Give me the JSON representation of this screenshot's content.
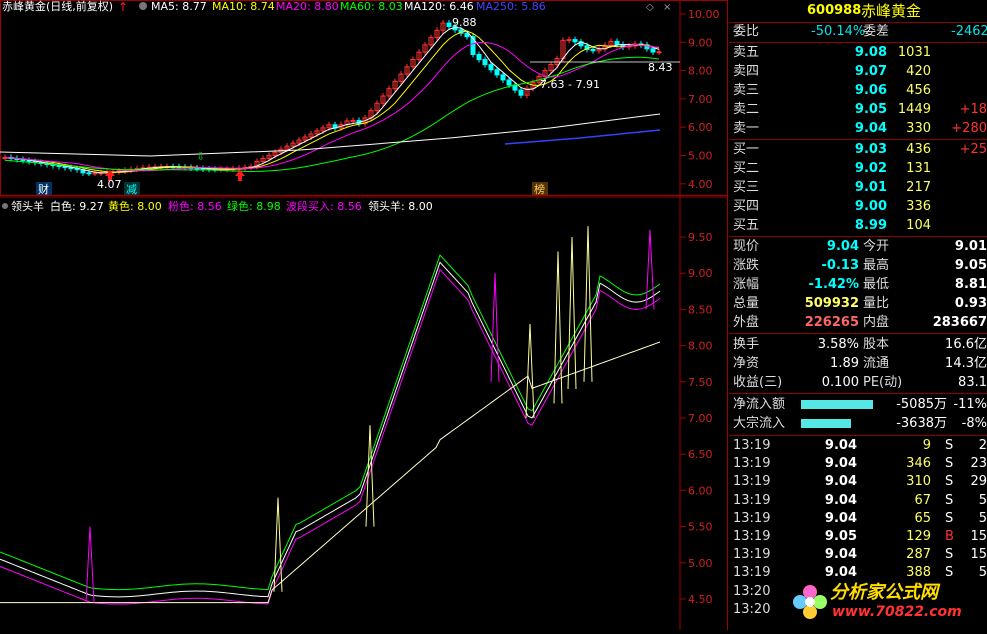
{
  "header": {
    "title": "赤峰黄金(日线,前复权)",
    "ma": [
      {
        "label": "MA5: 8.77",
        "color": "#ffffff"
      },
      {
        "label": "MA10: 8.74",
        "color": "#ffff00"
      },
      {
        "label": "MA20: 8.80",
        "color": "#ff00ff"
      },
      {
        "label": "MA60: 8.03",
        "color": "#00ff00"
      },
      {
        "label": "MA120: 6.46",
        "color": "#ffffff"
      },
      {
        "label": "MA250: 5.86",
        "color": "#4444ff"
      }
    ]
  },
  "upper_axis": [
    "10.00",
    "9.00",
    "8.00",
    "7.00",
    "6.00",
    "5.00",
    "4.00"
  ],
  "upper_annotations": {
    "high": "9.88",
    "low": "4.07",
    "range": "7.63 - 7.91",
    "right": "8.43",
    "marker_cai": "财",
    "marker_jian": "减",
    "marker_bang": "榜"
  },
  "indicator_header": {
    "name": "领头羊",
    "items": [
      {
        "label": "白色: 9.27",
        "color": "#ffffff"
      },
      {
        "label": "黄色: 8.00",
        "color": "#ffff00"
      },
      {
        "label": "粉色: 8.56",
        "color": "#ff00ff"
      },
      {
        "label": "绿色: 8.98",
        "color": "#00ff00"
      },
      {
        "label": "波段买入: 8.56",
        "color": "#ff00ff"
      },
      {
        "label": "领头羊: 8.00",
        "color": "#ffffff"
      }
    ]
  },
  "lower_axis": [
    "9.50",
    "9.00",
    "8.50",
    "8.00",
    "7.50",
    "7.00",
    "6.50",
    "6.00",
    "5.50",
    "5.00",
    "4.50"
  ],
  "quote": {
    "code": "600988",
    "name": "赤峰黄金",
    "weibi_label": "委比",
    "weibi": "-50.14%",
    "weicha_label": "委差",
    "weicha": "-2462",
    "sell": [
      {
        "label": "卖五",
        "price": "9.08",
        "vol": "1031",
        "chg": ""
      },
      {
        "label": "卖四",
        "price": "9.07",
        "vol": "420",
        "chg": ""
      },
      {
        "label": "卖三",
        "price": "9.06",
        "vol": "456",
        "chg": ""
      },
      {
        "label": "卖二",
        "price": "9.05",
        "vol": "1449",
        "chg": "+18"
      },
      {
        "label": "卖一",
        "price": "9.04",
        "vol": "330",
        "chg": "+280"
      }
    ],
    "buy": [
      {
        "label": "买一",
        "price": "9.03",
        "vol": "436",
        "chg": "+25"
      },
      {
        "label": "买二",
        "price": "9.02",
        "vol": "131",
        "chg": ""
      },
      {
        "label": "买三",
        "price": "9.01",
        "vol": "217",
        "chg": ""
      },
      {
        "label": "买四",
        "price": "9.00",
        "vol": "336",
        "chg": ""
      },
      {
        "label": "买五",
        "price": "8.99",
        "vol": "104",
        "chg": ""
      }
    ],
    "stats": [
      {
        "l1": "现价",
        "v1": "9.04",
        "l2": "今开",
        "v2": "9.01"
      },
      {
        "l1": "涨跌",
        "v1": "-0.13",
        "l2": "最高",
        "v2": "9.05"
      },
      {
        "l1": "涨幅",
        "v1": "-1.42%",
        "l2": "最低",
        "v2": "8.81"
      },
      {
        "l1": "总量",
        "v1": "509932",
        "l2": "量比",
        "v2": "0.93"
      },
      {
        "l1": "外盘",
        "v1": "226265",
        "l2": "内盘",
        "v2": "283667"
      }
    ],
    "finance": [
      {
        "l1": "换手",
        "v1": "3.58%",
        "l2": "股本",
        "v2": "16.6亿"
      },
      {
        "l1": "净资",
        "v1": "1.89",
        "l2": "流通",
        "v2": "14.3亿"
      },
      {
        "l1": "收益(三)",
        "v1": "0.100",
        "l2": "PE(动)",
        "v2": "83.1"
      }
    ],
    "flow": [
      {
        "label": "净流入额",
        "value": "-5085万",
        "pct": "-11%"
      },
      {
        "label": "大宗流入",
        "value": "-3638万",
        "pct": "-8%"
      }
    ]
  },
  "ticks": [
    {
      "time": "13:19",
      "price": "9.04",
      "vol": "9",
      "side": "S",
      "extra": "2"
    },
    {
      "time": "13:19",
      "price": "9.04",
      "vol": "346",
      "side": "S",
      "extra": "23"
    },
    {
      "time": "13:19",
      "price": "9.04",
      "vol": "310",
      "side": "S",
      "extra": "29"
    },
    {
      "time": "13:19",
      "price": "9.04",
      "vol": "67",
      "side": "S",
      "extra": "5"
    },
    {
      "time": "13:19",
      "price": "9.04",
      "vol": "65",
      "side": "S",
      "extra": "5"
    },
    {
      "time": "13:19",
      "price": "9.05",
      "vol": "129",
      "side": "B",
      "extra": "15"
    },
    {
      "time": "13:19",
      "price": "9.04",
      "vol": "287",
      "side": "S",
      "extra": "15"
    },
    {
      "time": "13:19",
      "price": "9.04",
      "vol": "388",
      "side": "S",
      "extra": "5"
    },
    {
      "time": "13:20",
      "price": "",
      "vol": "",
      "side": "",
      "extra": ""
    },
    {
      "time": "13:20",
      "price": "",
      "vol": "",
      "side": "",
      "extra": ""
    }
  ],
  "watermark": {
    "line1": "分析家公式网",
    "line2": "www.70822.com"
  },
  "colors": {
    "red": "#ff3232",
    "green": "#00e600",
    "yellow": "#ffff00",
    "magenta": "#ff00ff",
    "cyan": "#00ffff",
    "white": "#ffffff",
    "border": "#a00000"
  }
}
